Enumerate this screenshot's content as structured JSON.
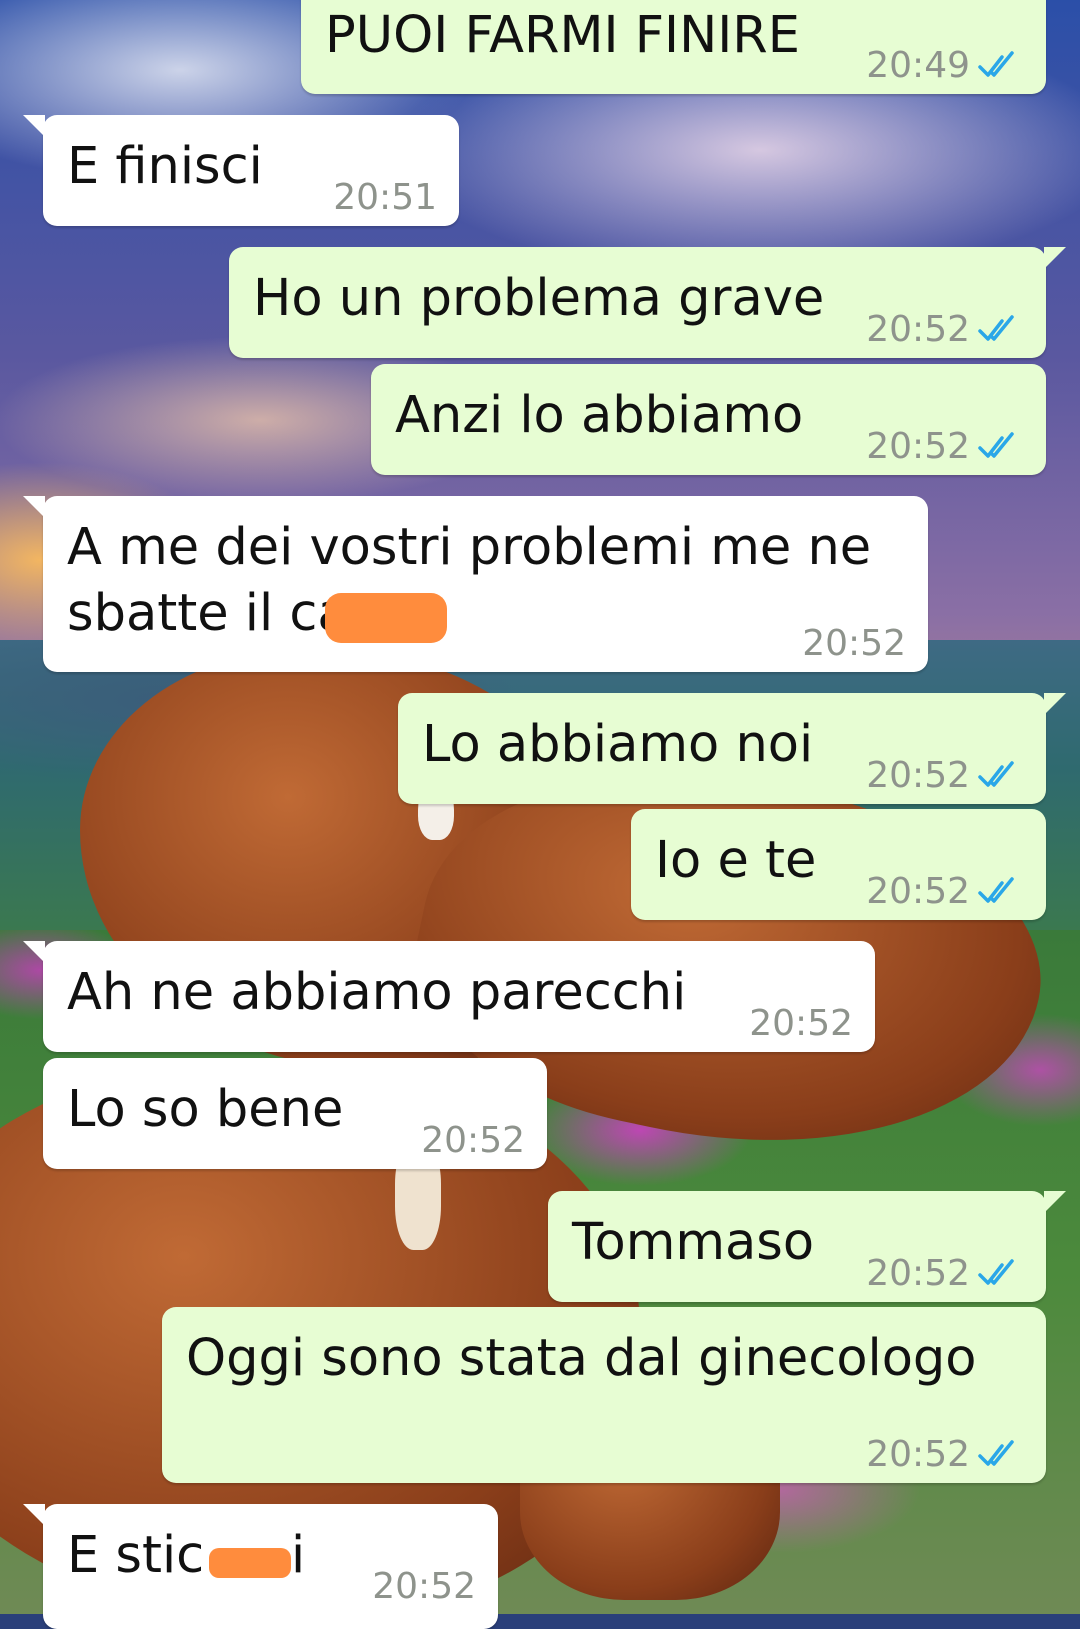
{
  "colors": {
    "incoming_bubble": "#ffffff",
    "outgoing_bubble": "#e7fdd3",
    "timestamp": "#8e938c",
    "read_ticks": "#2aa7e8",
    "redaction": "#ff8c3d"
  },
  "chat": {
    "messages": [
      {
        "direction": "outgoing",
        "text": "PUOI FARMI FINIRE",
        "time": "20:49",
        "status_icon": "double-check-read-icon"
      },
      {
        "direction": "incoming",
        "text": "E finisci",
        "time": "20:51"
      },
      {
        "direction": "outgoing",
        "text": "Ho un problema grave",
        "time": "20:52",
        "status_icon": "double-check-read-icon"
      },
      {
        "direction": "outgoing",
        "text": "Anzi lo abbiamo",
        "time": "20:52",
        "status_icon": "double-check-read-icon"
      },
      {
        "direction": "incoming",
        "text_line1": "A me dei vostri problemi me ne",
        "text_line2": "sbatte il ca",
        "time": "20:52"
      },
      {
        "direction": "outgoing",
        "text": "Lo abbiamo noi",
        "time": "20:52",
        "status_icon": "double-check-read-icon"
      },
      {
        "direction": "outgoing",
        "text": "Io e te",
        "time": "20:52",
        "status_icon": "double-check-read-icon"
      },
      {
        "direction": "incoming",
        "text": "Ah ne abbiamo parecchi",
        "time": "20:52"
      },
      {
        "direction": "incoming",
        "text": "Lo so bene",
        "time": "20:52"
      },
      {
        "direction": "outgoing",
        "text": "Tommaso",
        "time": "20:52",
        "status_icon": "double-check-read-icon"
      },
      {
        "direction": "outgoing",
        "text": "Oggi sono stata dal ginecologo",
        "time": "20:52",
        "status_icon": "double-check-read-icon"
      },
      {
        "direction": "incoming",
        "text": "E stic",
        "text_tail": "i",
        "time": "20:52"
      }
    ]
  }
}
